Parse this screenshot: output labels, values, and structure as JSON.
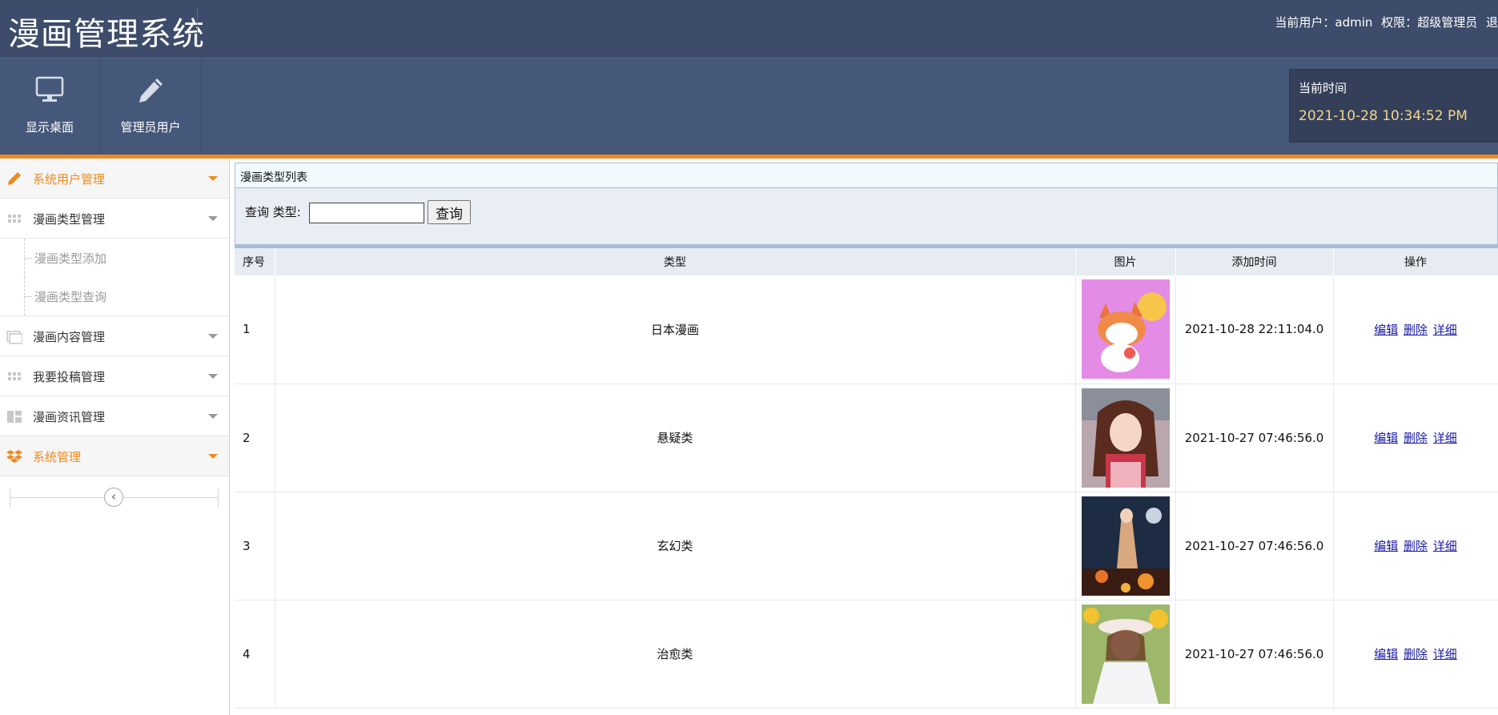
{
  "header": {
    "title": "漫画管理系统",
    "user_label": "当前用户：",
    "username": "admin",
    "role_label": "权限：",
    "role": "超级管理员",
    "logout_label": "退"
  },
  "toolbar": {
    "desktop_label": "显示桌面",
    "admin_user_label": "管理员用户"
  },
  "clock": {
    "label": "当前时间",
    "value": "2021-10-28 10:34:52 PM"
  },
  "sidebar": {
    "items": [
      {
        "label": "系统用户管理",
        "icon": "pencil-icon",
        "style": "orange"
      },
      {
        "label": "漫画类型管理",
        "icon": "grid-icon",
        "style": "normal"
      },
      {
        "label": "漫画类型添加",
        "style": "sub"
      },
      {
        "label": "漫画类型查询",
        "style": "sub"
      },
      {
        "label": "漫画内容管理",
        "icon": "image-icon",
        "style": "normal"
      },
      {
        "label": "我要投稿管理",
        "icon": "grid-icon",
        "style": "normal"
      },
      {
        "label": "漫画资讯管理",
        "icon": "layout-icon",
        "style": "normal"
      },
      {
        "label": "系统管理",
        "icon": "dropbox-icon",
        "style": "orange"
      }
    ],
    "collapse_glyph": "‹"
  },
  "main": {
    "panel_title": "漫画类型列表",
    "search": {
      "label": "查询 类型:",
      "value": "",
      "button": "查询"
    },
    "table": {
      "headers": [
        "序号",
        "类型",
        "图片",
        "添加时间",
        "操作"
      ],
      "rows": [
        {
          "no": "1",
          "type": "日本漫画",
          "image": "fox-mascot",
          "time": "2021-10-28 22:11:04.0"
        },
        {
          "no": "2",
          "type": "悬疑类",
          "image": "anime-girl-red",
          "time": "2021-10-27 07:46:56.0"
        },
        {
          "no": "3",
          "type": "玄幻类",
          "image": "fantasy-night",
          "time": "2021-10-27 07:46:56.0"
        },
        {
          "no": "4",
          "type": "治愈类",
          "image": "sunflower-girl",
          "time": "2021-10-27 07:46:56.0"
        }
      ],
      "ops": {
        "edit": "编辑",
        "delete": "删除",
        "detail": "详细"
      }
    }
  },
  "colors": {
    "header_bg": "#3c4c6a",
    "toolbar_bg": "#46587a",
    "accent": "#ef8a21",
    "clock_time": "#f3d589",
    "link": "#1a1aa6"
  }
}
